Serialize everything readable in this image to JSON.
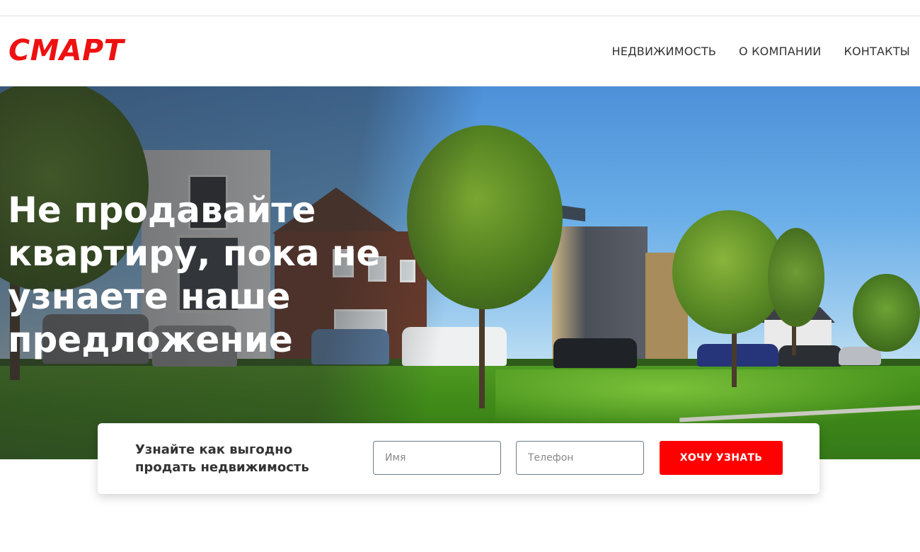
{
  "brand": {
    "logo_text": "СМАРТ",
    "color": "#ee1111"
  },
  "nav": {
    "items": [
      {
        "label": "НЕДВИЖИМОСТЬ"
      },
      {
        "label": "О КОМПАНИИ"
      },
      {
        "label": "КОНТАКТЫ"
      }
    ]
  },
  "hero": {
    "title": "Не продавайте квартиру, пока не узнаете наше предложение"
  },
  "lead_form": {
    "title": "Узнайте как выгодно продать недвижимость",
    "name_placeholder": "Имя",
    "name_value": "",
    "phone_placeholder": "Телефон",
    "phone_value": "",
    "submit_label": "ХОЧУ УЗНАТЬ",
    "accent_color": "#ff0000"
  }
}
